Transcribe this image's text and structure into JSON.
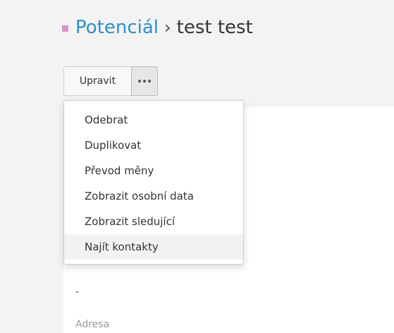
{
  "header": {
    "breadcrumb_link": "Potenciál",
    "separator": "›",
    "current": "test test",
    "accent_color": "#d896c9",
    "link_color": "#2f8fc7"
  },
  "toolbar": {
    "edit_label": "Upravit",
    "more_icon": "ellipsis-icon"
  },
  "dropdown": {
    "items": [
      {
        "label": "Odebrat"
      },
      {
        "label": "Duplikovat"
      },
      {
        "label": "Převod měny"
      },
      {
        "label": "Zobrazit osobní data"
      },
      {
        "label": "Zobrazit sledující"
      },
      {
        "label": "Najít kontakty",
        "hovered": true
      }
    ]
  },
  "detail": {
    "value": "-",
    "label": "Adresa"
  }
}
